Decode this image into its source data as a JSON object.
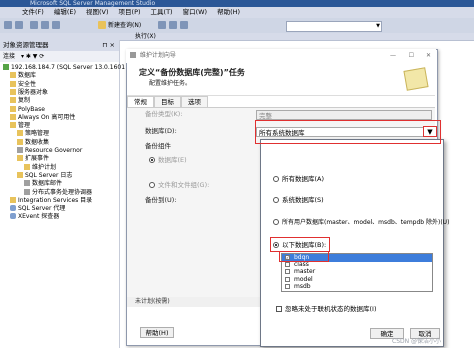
{
  "app": {
    "window_title": "Microsoft SQL Server Management Studio",
    "menu": [
      "文件(F)",
      "编辑(E)",
      "视图(V)",
      "项目(P)",
      "工具(T)",
      "窗口(W)",
      "帮助(H)"
    ],
    "toolbar": {
      "new_query": "新建查询(N)",
      "execute": "执行(X)",
      "debug": "调试(D)"
    }
  },
  "explorer": {
    "title": "对象资源管理器",
    "connect": "连接",
    "tree": [
      {
        "label": "192.168.184.7 (SQL Server 13.0.1601",
        "icon": "server-icon",
        "indent": 0
      },
      {
        "label": "数据库",
        "icon": "folder-icon",
        "indent": 1
      },
      {
        "label": "安全性",
        "icon": "folder-icon",
        "indent": 1
      },
      {
        "label": "服务器对象",
        "icon": "folder-icon",
        "indent": 1
      },
      {
        "label": "复制",
        "icon": "folder-icon",
        "indent": 1
      },
      {
        "label": "PolyBase",
        "icon": "folder-icon",
        "indent": 1
      },
      {
        "label": "Always On 高可用性",
        "icon": "folder-icon",
        "indent": 1
      },
      {
        "label": "管理",
        "icon": "folder-icon",
        "indent": 1
      },
      {
        "label": "策略管理",
        "icon": "folder-icon",
        "indent": 2
      },
      {
        "label": "数据收集",
        "icon": "folder-icon",
        "indent": 2
      },
      {
        "label": "Resource Governor",
        "icon": "gray-icon",
        "indent": 2
      },
      {
        "label": "扩展事件",
        "icon": "folder-icon",
        "indent": 2
      },
      {
        "label": "维护计划",
        "icon": "folder-icon",
        "indent": 3
      },
      {
        "label": "SQL Server 日志",
        "icon": "folder-icon",
        "indent": 2
      },
      {
        "label": "数据库邮件",
        "icon": "gray-icon",
        "indent": 3
      },
      {
        "label": "分布式事务处理协调器",
        "icon": "gray-icon",
        "indent": 3
      },
      {
        "label": "Integration Services 目录",
        "icon": "folder-icon",
        "indent": 1
      },
      {
        "label": "SQL Server 代理",
        "icon": "db-icon",
        "indent": 1
      },
      {
        "label": "XEvent 探查器",
        "icon": "db-icon",
        "indent": 1
      }
    ]
  },
  "dialog": {
    "title": "维护计划向导",
    "heading": "定义“备份数据库(完整)”任务",
    "subheading": "配置维护任务。",
    "tabs": [
      "常规",
      "目标",
      "选项"
    ],
    "backup_type_label": "备份类型(K):",
    "backup_type_value": "完整",
    "database_label": "数据库(D):",
    "database_value": "所有系统数据库",
    "backup_component_label": "备份组件",
    "component_database": "数据库(E)",
    "component_files": "文件和文件组(G):",
    "backup_to_label": "备份到(U):",
    "status_text": "未计划(按需)",
    "help_button": "帮助(H)"
  },
  "popup": {
    "options": [
      {
        "label": "所有数据库(A)",
        "selected": false
      },
      {
        "label": "系统数据库(S)",
        "selected": false
      },
      {
        "label": "所有用户数据库(master、model、msdb、tempdb 除外)(U)",
        "selected": false
      },
      {
        "label": "以下数据库(B):",
        "selected": true
      }
    ],
    "databases": [
      {
        "name": "bdqn",
        "checked": true,
        "selected": true
      },
      {
        "name": "class",
        "checked": false,
        "selected": false
      },
      {
        "name": "master",
        "checked": false,
        "selected": false
      },
      {
        "name": "model",
        "checked": false,
        "selected": false
      },
      {
        "name": "msdb",
        "checked": false,
        "selected": false
      }
    ],
    "ignore_offline": "忽略未处于联机状态的数据库(I)",
    "ok": "确定",
    "cancel": "取消"
  },
  "watermark": "CSDN @保洁小小"
}
